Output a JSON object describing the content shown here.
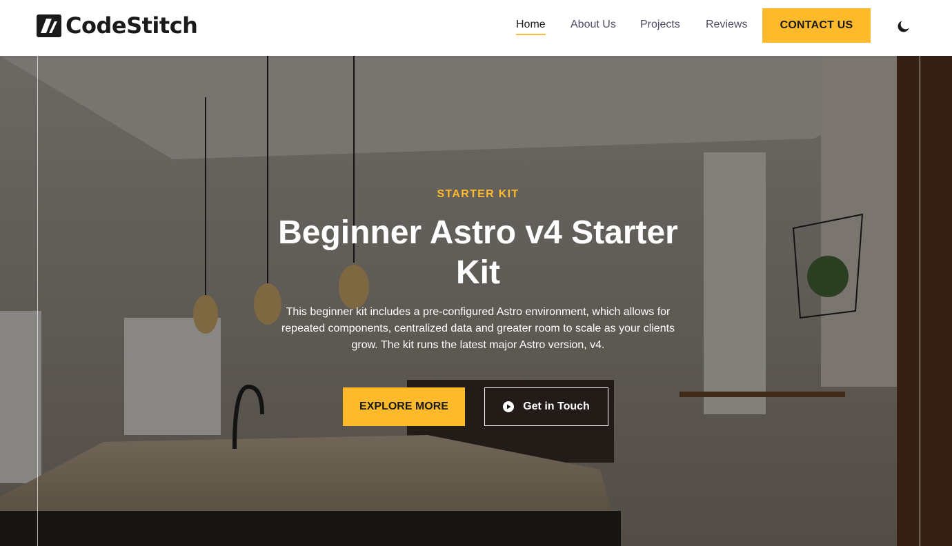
{
  "header": {
    "logo_text": "CodeStitch",
    "nav": [
      {
        "label": "Home",
        "active": true
      },
      {
        "label": "About Us",
        "active": false
      },
      {
        "label": "Projects",
        "active": false
      },
      {
        "label": "Reviews",
        "active": false
      }
    ],
    "contact_label": "CONTACT US",
    "theme_icon": "moon-icon"
  },
  "hero": {
    "eyebrow": "STARTER KIT",
    "title": "Beginner Astro v4 Starter Kit",
    "description": "This beginner kit includes a pre-configured Astro environment, which allows for repeated components, centralized data and greater room to scale as your clients grow. The kit runs the latest major Astro version, v4.",
    "primary_button": "EXPLORE MORE",
    "secondary_button": "Get in Touch",
    "secondary_icon": "play-circle-icon",
    "background": "kitchen-interior-photo"
  },
  "colors": {
    "accent": "#ffba2b",
    "text_dark": "#1a1a1a",
    "nav_text": "#4e4b66"
  }
}
